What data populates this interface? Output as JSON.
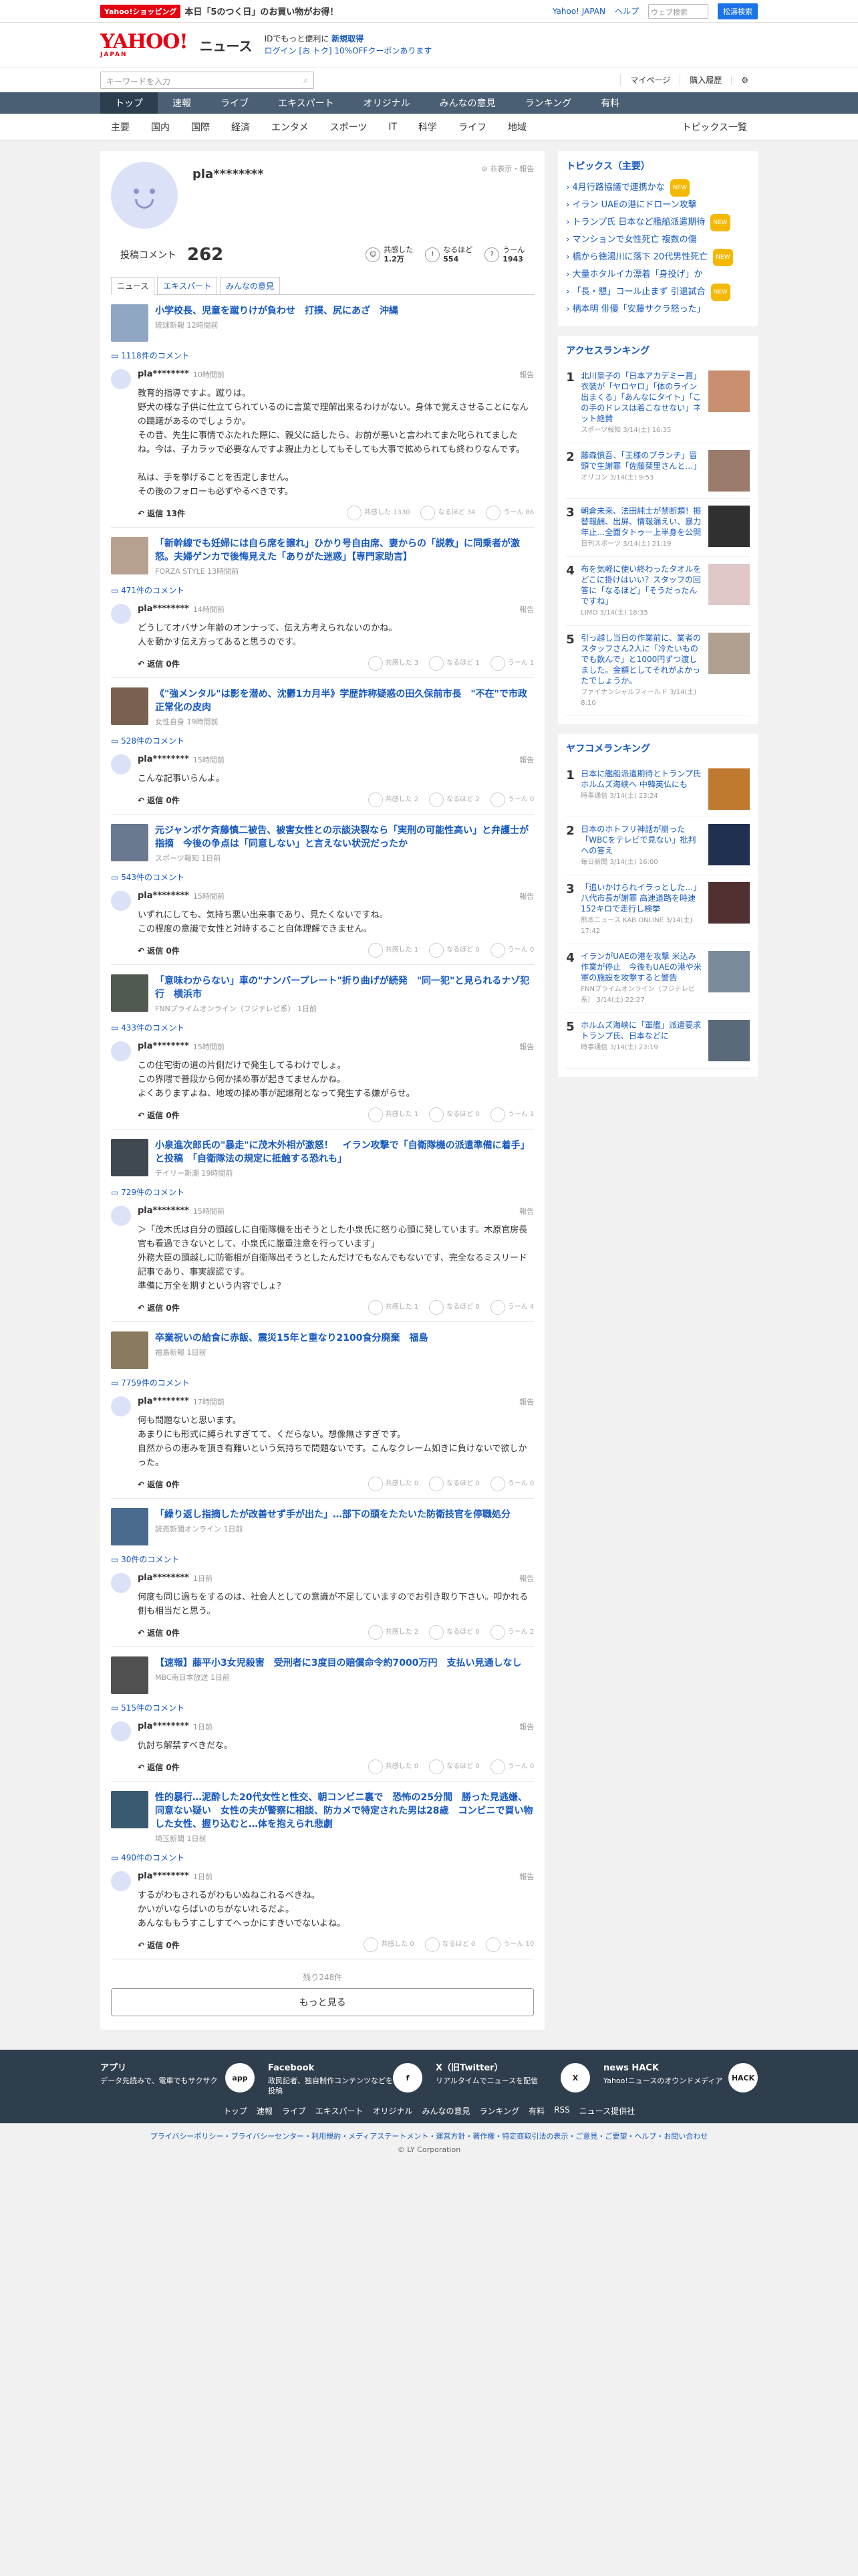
{
  "top": {
    "promo_tag": "Yahoo!ショッピング",
    "promo": "本日「5のつく日」のお買い物がお得！",
    "links": [
      "Yahoo! JAPAN",
      "ヘルプ"
    ],
    "search_placeholder": "ウェブ検索",
    "search_btn": "松濤検索"
  },
  "header": {
    "logo": "YAHOO!",
    "logo_sub": "JAPAN",
    "title": "ニュース",
    "msg1": "IDでもっと便利に",
    "msg1b": "新規取得",
    "msg2": "ログイン",
    "msg3": "[お トク] 10%OFFクーポンあります"
  },
  "searchrow": {
    "placeholder": "キーワードを入力",
    "mypage": "マイページ",
    "history": "購入履歴"
  },
  "nav": [
    "トップ",
    "速報",
    "ライブ",
    "エキスパート",
    "オリジナル",
    "みんなの意見",
    "ランキング",
    "有料"
  ],
  "subnav": [
    "主要",
    "国内",
    "国際",
    "経済",
    "エンタメ",
    "スポーツ",
    "IT",
    "科学",
    "ライフ",
    "地域"
  ],
  "subnav_right": "トピックス一覧",
  "profile": {
    "name": "pla********",
    "report": "非表示・報告",
    "comments_label": "投稿コメント",
    "comments": "262",
    "r1": "共感した",
    "r1v": "1.2万",
    "r2": "なるほど",
    "r2v": "554",
    "r3": "うーん",
    "r3v": "1943"
  },
  "tabs": [
    "ニュース",
    "エキスパート",
    "みんなの意見"
  ],
  "items": [
    {
      "title": "小学校長、児童を蹴りけが負わせ　打撲、尻にあざ　沖縄",
      "src": "琉球新報 12時間前",
      "count": "1118件のコメント",
      "user": "pla********",
      "time": "10時間前",
      "text": "教育的指導ですよ。蹴りは。\n野犬の様な子供に仕立てられているのに言葉で理解出来るわけがない。身体で覚えさせることになんの躊躇があるのでしょうか。\nその昔、先生に事情でぶたれた際に、親父に話したら、お前が悪いと言われてまた叱られてましたね。今は、子カラッで必要なんですよ親止力としてもそしても大事で拡められても終わりなんです。\n\n私は、手を挙げることを否定しません。\nその後のフォローも必ずやるべきです。",
      "reply": "返信 13件",
      "a": "共感した 1330",
      "b": "なるほど 34",
      "c": "うーん 86",
      "col": "#8fa7c2"
    },
    {
      "title": "「新幹線でも妊婦には自ら席を譲れ」ひかり号自由席、妻からの「説教」に同乗者が激怒。夫婦ゲンカで後悔見えた「ありがた迷惑」【専門家助言】",
      "src": "FORZA STYLE 13時間前",
      "count": "471件のコメント",
      "user": "pla********",
      "time": "14時間前",
      "text": "どうしてオバサン年齢のオンナって、伝え方考えられないのかね。\n人を動かす伝え方ってあると思うのです。",
      "reply": "返信 0件",
      "a": "共感した 3",
      "b": "なるほど 1",
      "c": "うーん 1",
      "col": "#b8a090"
    },
    {
      "title": "《\"強メンタル\"は影を潜め、沈鬱1カ月半》学歴詐称疑惑の田久保前市長　\"不在\"で市政正常化の皮肉",
      "src": "女性自身 19時間前",
      "count": "528件のコメント",
      "user": "pla********",
      "time": "15時間前",
      "text": "こんな記事いらんよ。",
      "reply": "返信 0件",
      "a": "共感した 2",
      "b": "なるほど 2",
      "c": "うーん 0",
      "col": "#7a6050"
    },
    {
      "title": "元ジャンポケ斉藤慎二被告、被害女性との示談決裂なら「実刑の可能性高い」と弁護士が指摘　今後の争点は「同意しない」と言えない状況だったか",
      "src": "スポーツ報知 1日前",
      "count": "543件のコメント",
      "user": "pla********",
      "time": "15時間前",
      "text": "いずれにしても、気持ち悪い出来事であり、見たくないですね。\nこの程度の意識で女性と対峙すること自体理解できません。",
      "reply": "返信 0件",
      "a": "共感した 1",
      "b": "なるほど 0",
      "c": "うーん 0",
      "col": "#6a7890"
    },
    {
      "title": "「意味わからない」車の\"ナンバープレート\"折り曲げが続発　\"同一犯\"と見られるナゾ犯行　横浜市",
      "src": "FNNプライムオンライン（フジテレビ系） 1日前",
      "count": "433件のコメント",
      "user": "pla********",
      "time": "15時間前",
      "text": "この住宅街の道の片側だけで発生してるわけでしょ。\nこの界隈で普段から何か揉め事が起きてませんかね。\nよくありますよね、地域の揉め事が起爆剤となって発生する嫌がらせ。",
      "reply": "返信 0件",
      "a": "共感した 1",
      "b": "なるほど 0",
      "c": "うーん 1",
      "col": "#505a50"
    },
    {
      "title": "小泉進次郎氏の\"暴走\"に茂木外相が激怒！　イラン攻撃で「自衛隊機の派遣準備に着手」と投稿　「自衛隊法の規定に抵触する恐れも」",
      "src": "デイリー新潮 19時間前",
      "count": "729件のコメント",
      "user": "pla********",
      "time": "15時間前",
      "text": "＞「茂木氏は自分の頭越しに自衛隊機を出そうとした小泉氏に怒り心頭に発しています。木原官房長官も看過できないとして、小泉氏に厳重注意を行っています」\n外務大臣の頭越しに防衛相が自衛隊出そうとしたんだけでもなんでもないです、完全なるミスリード記事であり、事実誤認です。\n準備に万全を期すという内容でしょ？",
      "reply": "返信 0件",
      "a": "共感した 1",
      "b": "なるほど 0",
      "c": "うーん 4",
      "col": "#404850"
    },
    {
      "title": "卒業祝いの給食に赤飯、震災15年と重なり2100食分廃棄　福島",
      "src": "福島新報 1日前",
      "count": "7759件のコメント",
      "user": "pla********",
      "time": "17時間前",
      "text": "何も問題ないと思います。\nあまりにも形式に縛られすぎてて、くだらない。想像無さすぎです。\n自然からの恵みを頂き有難いという気持ちで問題ないです。こんなクレーム如きに負けないで欲しかった。",
      "reply": "返信 0件",
      "a": "共感した 0",
      "b": "なるほど 0",
      "c": "うーん 0",
      "col": "#8a7a60"
    },
    {
      "title": "「繰り返し指摘したが改善せず手が出た」…部下の頭をたたいた防衛技官を停職処分",
      "src": "読売新聞オンライン 1日前",
      "count": "30件のコメント",
      "user": "pla********",
      "time": "1日前",
      "text": "何度も同じ過ちをするのは、社会人としての意識が不足していますのでお引き取り下さい。叩かれる側も相当だと思う。",
      "reply": "返信 0件",
      "a": "共感した 2",
      "b": "なるほど 0",
      "c": "うーん 2",
      "col": "#4a6a90"
    },
    {
      "title": "【速報】藤平小3女児殺害　受刑者に3度目の賠償命令約7000万円　支払い見通しなし",
      "src": "MBC南日本放送 1日前",
      "count": "515件のコメント",
      "user": "pla********",
      "time": "1日前",
      "text": "仇討ち解禁すべきだな。",
      "reply": "返信 0件",
      "a": "共感した 0",
      "b": "なるほど 0",
      "c": "うーん 0",
      "col": "#505050"
    },
    {
      "title": "性的暴行…泥酔した20代女性と性交、朝コンビニ裏で　恐怖の25分間　勝った見逃嫌、同意ない疑い　女性の夫が警察に相談、防カメで特定された男は28歳　コンビニで買い物した女性、握り込むと…体を抱えられ悲劇",
      "src": "埼玉新聞 1日前",
      "count": "490件のコメント",
      "user": "pla********",
      "time": "1日前",
      "text": "するがわもされるがわもいぬねこれるべきね。\nかいがいならばいのちがないれるだよ。\nあんなももうすこしすてへっかにすきいでないよね。",
      "reply": "返信 0件",
      "a": "共感した 0",
      "b": "なるほど 0",
      "c": "うーん 10",
      "col": "#3a5a70"
    }
  ],
  "remaining": "残り248件",
  "more": "もっと見る",
  "side": {
    "topics_title": "トピックス（主要）",
    "topics": [
      {
        "t": "4月行路協議で連携かな",
        "n": "NEW"
      },
      {
        "t": "イラン UAEの港にドローン攻撃",
        "n": ""
      },
      {
        "t": "トランプ氏 日本など艦船派遣期待",
        "n": "NEW"
      },
      {
        "t": "マンションで女性死亡 複数の傷",
        "n": ""
      },
      {
        "t": "橋から徳湯川に落下 20代男性死亡",
        "n": "NEW"
      },
      {
        "t": "大量ホタルイカ漂着「身投げ」か",
        "n": ""
      },
      {
        "t": "「長・懇」コール止まず 引退試合",
        "n": "NEW"
      },
      {
        "t": "柄本明 俳優「安藤サクラ怒った」",
        "n": ""
      }
    ],
    "access_title": "アクセスランキング",
    "access": [
      {
        "t": "北川景子の「日本アカデミー賞」衣装が「ヤロヤロ」「体のライン出まくる」「あんなにタイト」「この手のドレスは着こなせない」ネット絶賛",
        "s": "スポーツ報知 3/14(土) 16:35",
        "c": "#c89070"
      },
      {
        "t": "藤森慎吾、「王様のブランチ」冒頭で生謝罪「佐藤栞里さんと…」",
        "s": "オリコン 3/14(土) 9:53",
        "c": "#9a7a6a"
      },
      {
        "t": "朝倉未来、法田純士が禁断類！振替報酬、出屏、情報漏えい、暴力年止…全面タトゥー上半身を公開",
        "s": "日刊スポーツ 3/14(土) 21:19",
        "c": "#303030"
      },
      {
        "t": "布を気軽に使い終わったタオルをどこに掛けはいい？スタッフの回答に「なるほど」「そうだったんですね」",
        "s": "LIMO 3/14(土) 18:35",
        "c": "#e0c8c8"
      },
      {
        "t": "引っ越し当日の作業前に、業者のスタッフさん2人に「冷たいものでも飲んで」と1000円ずつ渡しました。金額としてそれがよかったでしょうか。",
        "s": "ファイナンシャルフィールド 3/14(土) 8:10",
        "c": "#b0a090"
      }
    ],
    "yahoo_title": "ヤフコメランキング",
    "yahoo": [
      {
        "t": "日本に艦船派遣期待とトランプ氏 ホルムズ海峡へ 中韓英仏にも",
        "s": "時事通信 3/14(土) 23:24",
        "c": "#c07a30"
      },
      {
        "t": "日本のホトフリ神話が崩った「WBCをテレビで見ない」批判への答え",
        "s": "毎日新聞 3/14(土) 16:00",
        "c": "#203050"
      },
      {
        "t": "「追いかけられイラっとした…」八代市長が謝罪 高速道路を時速152キロで走行し検挙",
        "s": "熊本ニュース KAB ONLINE 3/14(土) 17:42",
        "c": "#503030"
      },
      {
        "t": "イランがUAEの港を攻撃 米込み作業が停止　今後もUAEの港や米軍の施設を攻撃すると警告",
        "s": "FNNプライムオンライン（フジテレビ系） 3/14(土) 22:27",
        "c": "#7a8a9a"
      },
      {
        "t": "ホルムズ海峡に「軍艦」派遣要求 トランプ氏、日本などに",
        "s": "時事通信 3/14(土) 23:19",
        "c": "#5a6a7a"
      }
    ]
  },
  "footer": {
    "apps": [
      {
        "title": "アプリ",
        "desc": "データ先読みで、電車でもサクサク",
        "icon": "app"
      },
      {
        "title": "Facebook",
        "desc": "政民記者、独自制作コンテンツなどを投稿",
        "icon": "f"
      },
      {
        "title": "X（旧Twitter）",
        "desc": "リアルタイムでニュースを配信",
        "icon": "X"
      },
      {
        "title": "news HACK",
        "desc": "Yahoo!ニュースのオウンドメディア",
        "icon": "HACK"
      }
    ],
    "links": [
      "トップ",
      "速報",
      "ライブ",
      "エキスパート",
      "オリジナル",
      "みんなの意見",
      "ランキング",
      "有料",
      "RSS",
      "ニュース提供社"
    ],
    "legal": "プライバシーポリシー・プライバシーセンター・利用規約・メディアステートメント・運営方針・著作権・特定商取引法の表示・ご意見・ご要望・ヘルプ・お問い合わせ",
    "copy": "© LY Corporation"
  }
}
